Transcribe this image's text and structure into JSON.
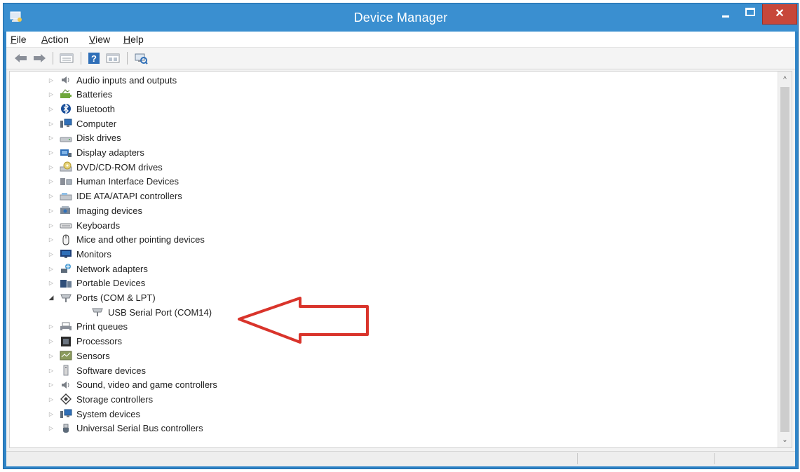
{
  "window": {
    "title": "Device Manager",
    "close_glyph": "✕"
  },
  "menu": [
    {
      "accel": "F",
      "rest": "ile"
    },
    {
      "accel": "A",
      "rest": "ction"
    },
    {
      "accel": "V",
      "rest": "iew"
    },
    {
      "accel": "H",
      "rest": "elp"
    }
  ],
  "toolbar": {
    "icons": [
      "back-arrow-icon",
      "forward-arrow-icon",
      "properties-icon",
      "help-icon",
      "view-icon",
      "scan-hardware-icon"
    ]
  },
  "tree": {
    "items": [
      {
        "label": "Audio inputs and outputs",
        "icon": "speaker-icon",
        "expanded": false
      },
      {
        "label": "Batteries",
        "icon": "battery-icon",
        "expanded": false
      },
      {
        "label": "Bluetooth",
        "icon": "bluetooth-icon",
        "expanded": false
      },
      {
        "label": "Computer",
        "icon": "computer-icon",
        "expanded": false
      },
      {
        "label": "Disk drives",
        "icon": "disk-drive-icon",
        "expanded": false
      },
      {
        "label": "Display adapters",
        "icon": "display-adapter-icon",
        "expanded": false
      },
      {
        "label": "DVD/CD-ROM drives",
        "icon": "dvd-drive-icon",
        "expanded": false
      },
      {
        "label": "Human Interface Devices",
        "icon": "hid-icon",
        "expanded": false
      },
      {
        "label": "IDE ATA/ATAPI controllers",
        "icon": "ide-controller-icon",
        "expanded": false
      },
      {
        "label": "Imaging devices",
        "icon": "camera-icon",
        "expanded": false
      },
      {
        "label": "Keyboards",
        "icon": "keyboard-icon",
        "expanded": false
      },
      {
        "label": "Mice and other pointing devices",
        "icon": "mouse-icon",
        "expanded": false
      },
      {
        "label": "Monitors",
        "icon": "monitor-icon",
        "expanded": false
      },
      {
        "label": "Network adapters",
        "icon": "network-adapter-icon",
        "expanded": false
      },
      {
        "label": "Portable Devices",
        "icon": "portable-device-icon",
        "expanded": false
      },
      {
        "label": "Ports (COM & LPT)",
        "icon": "port-icon",
        "expanded": true
      },
      {
        "label": "USB Serial Port (COM14)",
        "icon": "port-icon",
        "child": true
      },
      {
        "label": "Print queues",
        "icon": "printer-icon",
        "expanded": false
      },
      {
        "label": "Processors",
        "icon": "processor-icon",
        "expanded": false
      },
      {
        "label": "Sensors",
        "icon": "sensor-icon",
        "expanded": false
      },
      {
        "label": "Software devices",
        "icon": "software-device-icon",
        "expanded": false
      },
      {
        "label": "Sound, video and game controllers",
        "icon": "speaker-icon",
        "expanded": false
      },
      {
        "label": "Storage controllers",
        "icon": "storage-controller-icon",
        "expanded": false
      },
      {
        "label": "System devices",
        "icon": "system-device-icon",
        "expanded": false
      },
      {
        "label": "Universal Serial Bus controllers",
        "icon": "usb-icon",
        "expanded": false
      }
    ]
  },
  "colors": {
    "titlebar": "#3a8fd0",
    "close_button": "#c7473a",
    "annotation_arrow": "#d9342b"
  }
}
